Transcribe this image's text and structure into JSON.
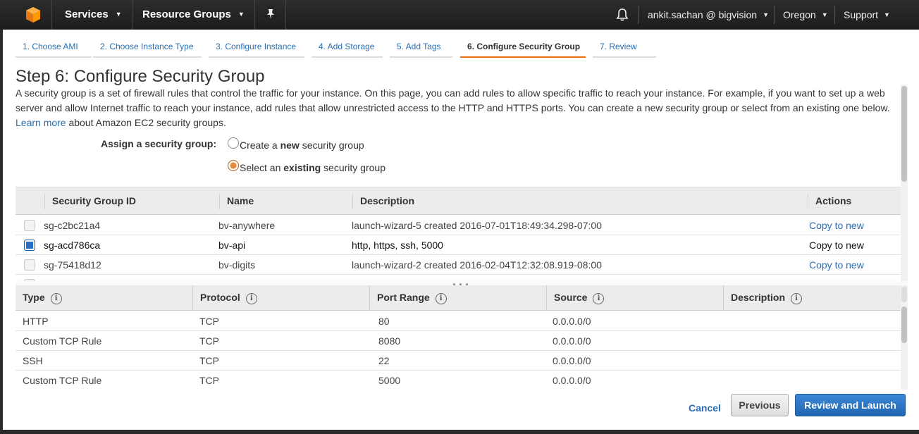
{
  "topbar": {
    "services_label": "Services",
    "resource_groups_label": "Resource Groups",
    "account_label": "ankit.sachan @ bigvision",
    "region_label": "Oregon",
    "support_label": "Support",
    "caret": "▼"
  },
  "wizard": {
    "tabs": [
      {
        "label": "1. Choose AMI"
      },
      {
        "label": "2. Choose Instance Type"
      },
      {
        "label": "3. Configure Instance"
      },
      {
        "label": "4. Add Storage"
      },
      {
        "label": "5. Add Tags"
      },
      {
        "label": "6. Configure Security Group"
      },
      {
        "label": "7. Review"
      }
    ],
    "active_tab": 5
  },
  "page": {
    "title": "Step 6: Configure Security Group",
    "intro_text": "A security group is a set of firewall rules that control the traffic for your instance. On this page, you can add rules to allow specific traffic to reach your instance. For example, if you want to set up a web server and allow Internet traffic to reach your instance, add rules that allow unrestricted access to the HTTP and HTTPS ports. You can create a new security group or select from an existing one below.",
    "learn_more": "Learn more",
    "intro_suffix": "about Amazon EC2 security groups."
  },
  "assign": {
    "label": "Assign a security group:",
    "option_new_pre": "Create a ",
    "option_new_bold": "new",
    "option_new_post": " security group",
    "option_existing_pre": "Select an ",
    "option_existing_bold": "existing",
    "option_existing_post": " security group",
    "selected": "existing"
  },
  "security_groups": {
    "headers": {
      "id": "Security Group ID",
      "name": "Name",
      "description": "Description",
      "actions": "Actions"
    },
    "rows": [
      {
        "id": "sg-c2bc21a4",
        "name": "bv-anywhere",
        "description": "launch-wizard-5 created 2016-07-01T18:49:34.298-07:00",
        "action": "Copy to new",
        "checked": false
      },
      {
        "id": "sg-acd786ca",
        "name": "bv-api",
        "description": "http, https, ssh, 5000",
        "action": "Copy to new",
        "checked": true
      },
      {
        "id": "sg-75418d12",
        "name": "bv-digits",
        "description": "launch-wizard-2 created 2016-02-04T12:32:08.919-08:00",
        "action": "Copy to new",
        "checked": false
      }
    ]
  },
  "rules": {
    "headers": {
      "type": "Type",
      "protocol": "Protocol",
      "port_range": "Port Range",
      "source": "Source",
      "description": "Description"
    },
    "info_glyph": "i",
    "rows": [
      {
        "type": "HTTP",
        "protocol": "TCP",
        "port_range": "80",
        "source": "0.0.0.0/0"
      },
      {
        "type": "Custom TCP Rule",
        "protocol": "TCP",
        "port_range": "8080",
        "source": "0.0.0.0/0"
      },
      {
        "type": "SSH",
        "protocol": "TCP",
        "port_range": "22",
        "source": "0.0.0.0/0"
      },
      {
        "type": "Custom TCP Rule",
        "protocol": "TCP",
        "port_range": "5000",
        "source": "0.0.0.0/0"
      }
    ]
  },
  "footer": {
    "cancel_label": "Cancel",
    "previous_label": "Previous",
    "launch_label": "Review and Launch"
  },
  "colors": {
    "accent": "#ec7211",
    "link": "#2a6db0",
    "primary_button": "#2570c6"
  }
}
